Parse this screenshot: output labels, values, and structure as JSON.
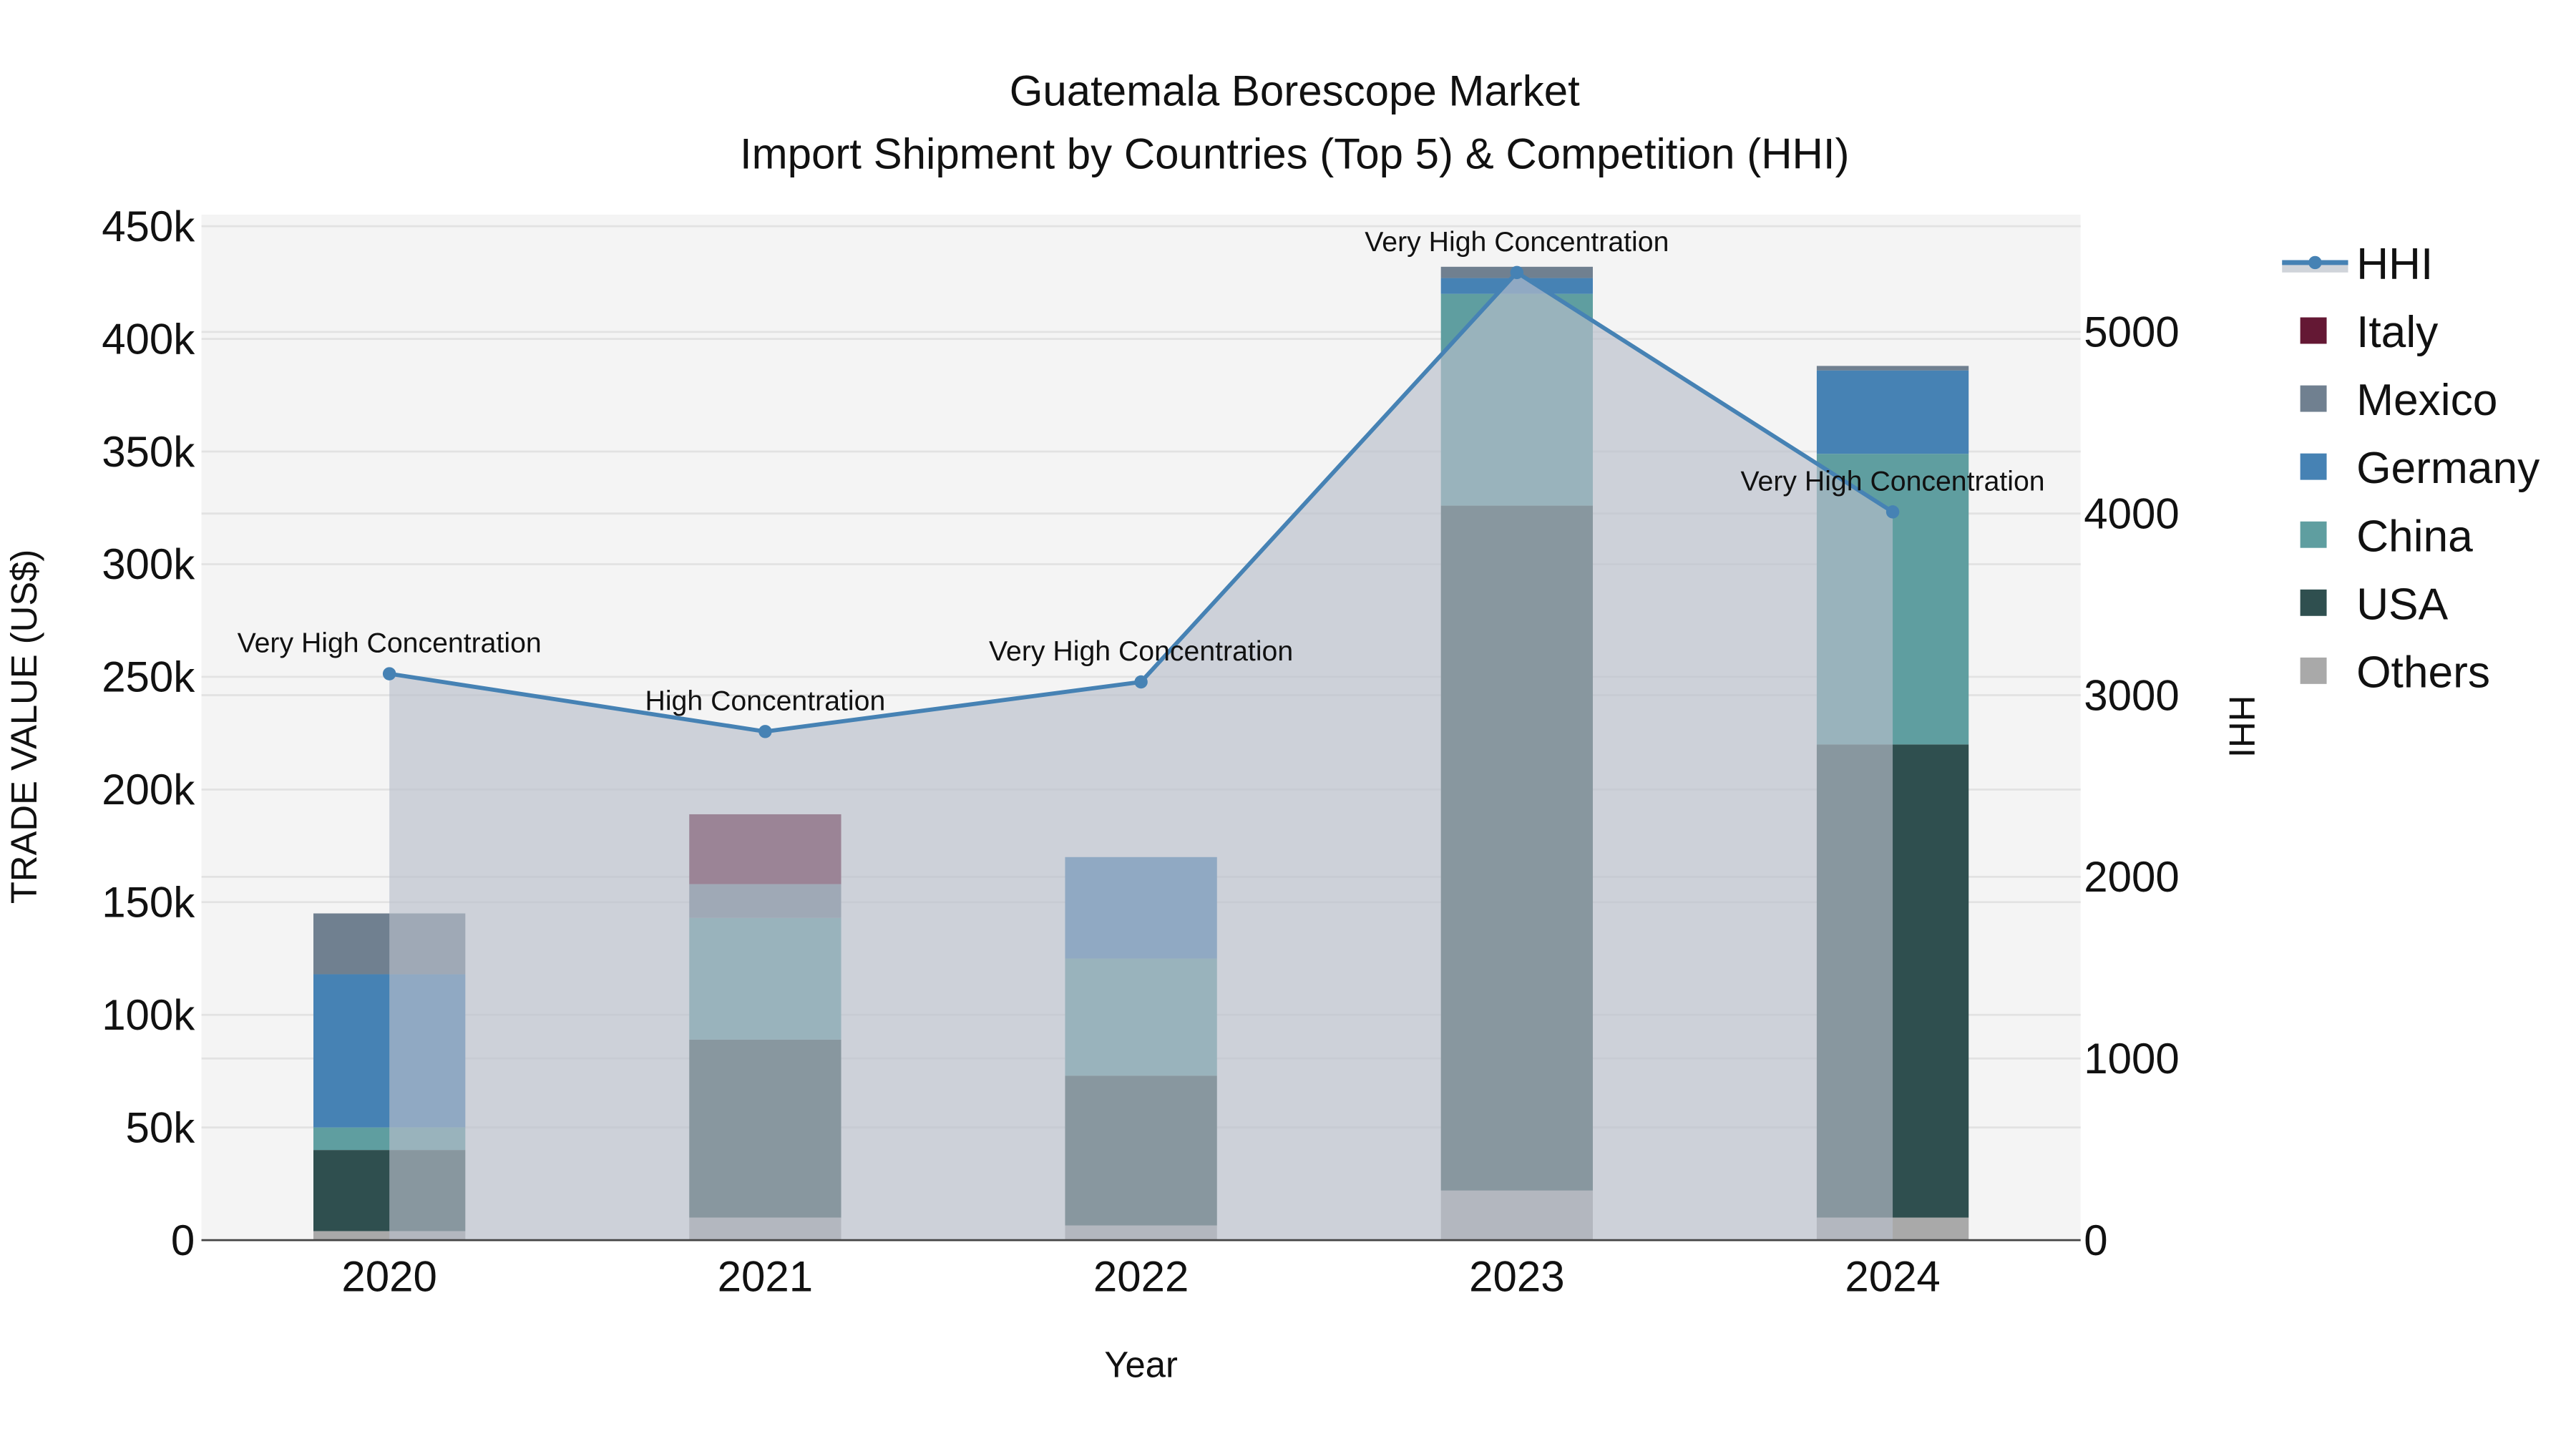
{
  "chart_data": {
    "type": "bar",
    "stacked": true,
    "title": "Guatemala Borescope Market",
    "subtitle": "Import Shipment by Countries (Top 5) & Competition (HHI)",
    "xlabel": "Year",
    "ylabel": "TRADE VALUE (US$)",
    "y2label": "HHI",
    "categories": [
      "2020",
      "2021",
      "2022",
      "2023",
      "2024"
    ],
    "ylim": [
      0,
      450000
    ],
    "y_ticks": [
      0,
      50000,
      100000,
      150000,
      200000,
      250000,
      300000,
      350000,
      400000,
      450000
    ],
    "y_tick_labels": [
      "0",
      "50k",
      "100k",
      "150k",
      "200k",
      "250k",
      "300k",
      "350k",
      "400k",
      "450k"
    ],
    "y2lim": [
      0,
      5600
    ],
    "y2_ticks": [
      0,
      1000,
      2000,
      3000,
      4000,
      5000
    ],
    "y2_tick_labels": [
      "0",
      "1000",
      "2000",
      "3000",
      "4000",
      "5000"
    ],
    "grid": true,
    "legend_position": "right",
    "series": [
      {
        "name": "Others",
        "color": "#a9a9a9",
        "values": [
          4000,
          10000,
          6500,
          22000,
          10000
        ]
      },
      {
        "name": "USA",
        "color": "#2f4f4f",
        "values": [
          36000,
          79000,
          66500,
          304000,
          210000
        ]
      },
      {
        "name": "China",
        "color": "#5f9ea0",
        "values": [
          10000,
          54000,
          52000,
          94000,
          129000
        ]
      },
      {
        "name": "Germany",
        "color": "#4682b4",
        "values": [
          68000,
          0,
          45000,
          7000,
          37000
        ]
      },
      {
        "name": "Mexico",
        "color": "#708090",
        "values": [
          27000,
          15000,
          0,
          5000,
          2000
        ]
      },
      {
        "name": "Italy",
        "color": "#641834",
        "values": [
          0,
          31000,
          0,
          0,
          0
        ]
      }
    ],
    "hhi": {
      "name": "HHI",
      "color": "#4682b4",
      "fill": "#b8bfcb",
      "values": [
        3118,
        2800,
        3073,
        5327,
        4009
      ],
      "labels": [
        "Very High Concentration",
        "High Concentration",
        "Very High Concentration",
        "Very High Concentration",
        "Very High Concentration"
      ]
    },
    "legend": [
      "HHI",
      "Italy",
      "Mexico",
      "Germany",
      "China",
      "USA",
      "Others"
    ]
  }
}
